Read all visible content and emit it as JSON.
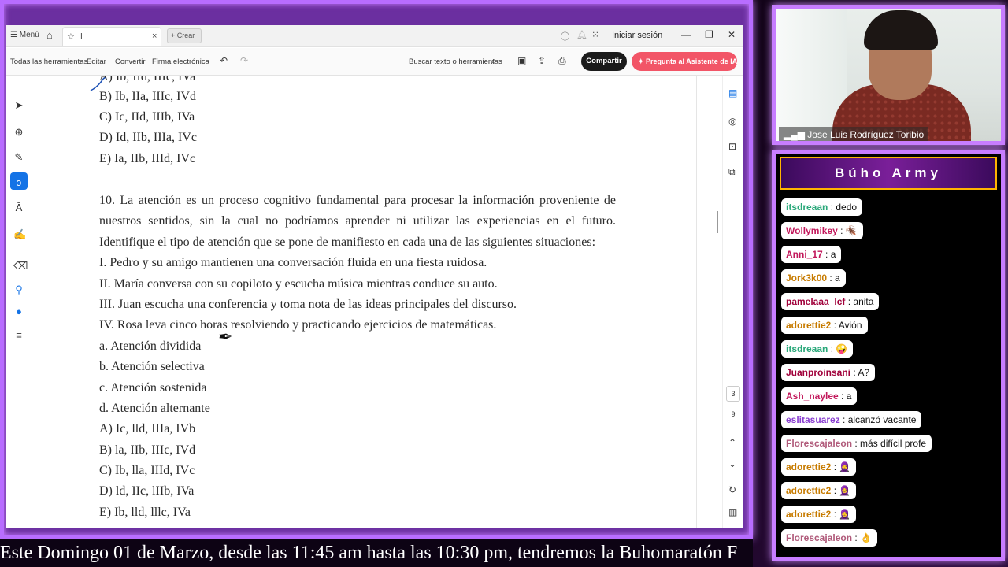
{
  "app": {
    "menu_label": "Menú",
    "tab_title": "I",
    "create_label": "Crear",
    "signin_label": "Iniciar sesión"
  },
  "toolbar": {
    "all_tools": "Todas las herramientas",
    "edit": "Editar",
    "convert": "Convertir",
    "esign": "Firma electrónica",
    "search_placeholder": "Buscar texto o herramientas",
    "share": "Compartir",
    "ai_assistant": "Pregunta al Asistente de IA"
  },
  "document": {
    "prev_options": [
      "A) Ib, IId, IIIc, IVa",
      "B) Ib, IIa, IIIc, IVd",
      "C) Ic, IId, IIIb, IVa",
      "D) Id, IIb, IIIa, IVc",
      "E) Ia, IIb, IIId, IVc"
    ],
    "q10_line1": "10. La atención es un proceso cognitivo fundamental para procesar la información proveniente de",
    "q10_line2": "nuestros sentidos, sin la cual no podríamos aprender ni utilizar las experiencias en el futuro.",
    "q10_line3": "Identifique el tipo de atención que se pone de manifiesto en cada una de las siguientes situaciones:",
    "situations": [
      "I. Pedro y su amigo mantienen una conversación fluida en una fiesta ruidosa.",
      "II. María conversa con su copiloto y escucha música mientras conduce su auto.",
      "III. Juan escucha una conferencia y toma nota de las ideas principales del discurso.",
      "IV. Rosa leva cinco horas resolviendo y practicando ejercicios de matemáticas."
    ],
    "types": [
      "a. Atención dividida",
      "b. Atención selectiva",
      "c. Atención sostenida",
      "d. Atención alternante"
    ],
    "options": [
      "A) Ic, lld, IIIa, IVb",
      "B) la, IIb, IIIc, IVd",
      "C) Ib, lla, IIId, IVc",
      "D) ld, IIc, lIIb, IVa",
      "E) Ib, lld, lllc, IVa"
    ],
    "page_current": "3",
    "page_total": "9"
  },
  "camera": {
    "name": "Jose Luis Rodríguez Toribio"
  },
  "chat": {
    "title": "Búho Army",
    "messages": [
      {
        "user": "itsdreaan",
        "text": "dedo",
        "color": "#2aa87a"
      },
      {
        "user": "Wollymikey",
        "text": "🪳",
        "color": "#c2185b"
      },
      {
        "user": "Anni_17",
        "text": "a",
        "color": "#c2185b"
      },
      {
        "user": "Jork3k00",
        "text": "a",
        "color": "#c77b00"
      },
      {
        "user": "pamelaaa_lcf",
        "text": "anita",
        "color": "#a0003a"
      },
      {
        "user": "adorettie2",
        "text": "Avión",
        "color": "#c77b00"
      },
      {
        "user": "itsdreaan",
        "text": "🤪",
        "color": "#2aa87a"
      },
      {
        "user": "Juanproinsani",
        "text": "A?",
        "color": "#a0003a"
      },
      {
        "user": "Ash_naylee",
        "text": "a",
        "color": "#c2185b"
      },
      {
        "user": "eslitasuarez",
        "text": "alcanzó vacante",
        "color": "#8a3fd1"
      },
      {
        "user": "Florescajaleon",
        "text": "más difícil profe",
        "color": "#b05a7a"
      },
      {
        "user": "adorettie2",
        "text": "🧕",
        "color": "#c77b00"
      },
      {
        "user": "adorettie2",
        "text": "🧕",
        "color": "#c77b00"
      },
      {
        "user": "adorettie2",
        "text": "🧕",
        "color": "#c77b00"
      },
      {
        "user": "Florescajaleon",
        "text": "👌",
        "color": "#b05a7a"
      }
    ]
  },
  "ticker": {
    "text": "Este Domingo 01 de Marzo, desde las 11:45 am hasta las 10:30 pm, tendremos la Buhomaratón F"
  },
  "icons": {
    "home": "home-icon",
    "star": "star-icon",
    "help": "help-icon",
    "bell": "bell-icon",
    "apps": "apps-grid-icon"
  }
}
